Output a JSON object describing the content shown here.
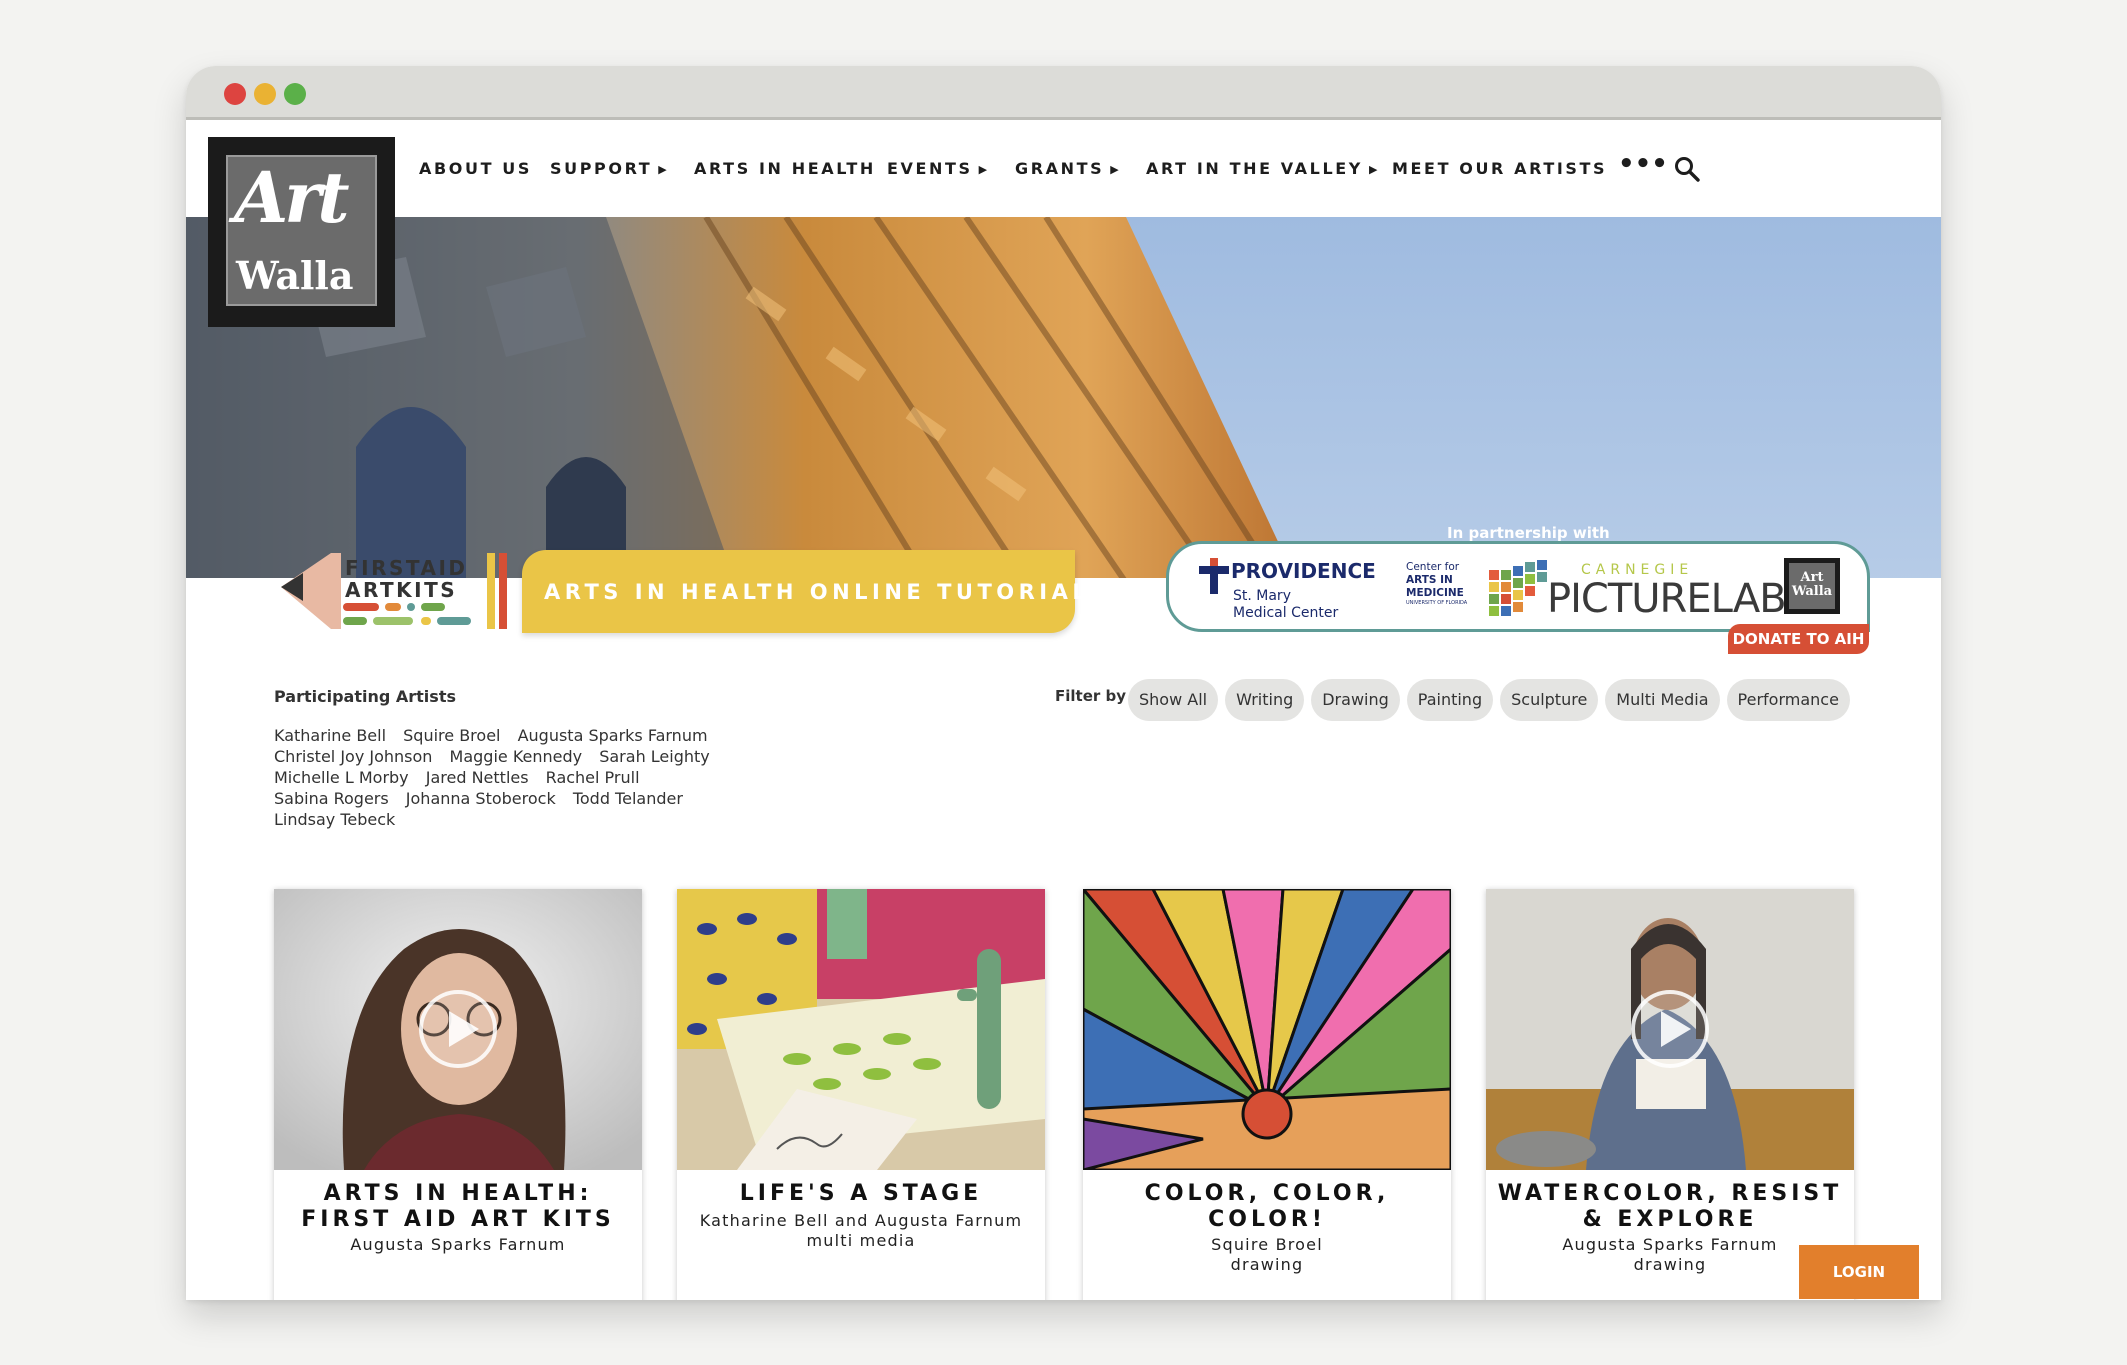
{
  "nav": {
    "about": "ABOUT US",
    "support": "SUPPORT",
    "arts_in_health": "ARTS IN HEALTH",
    "events": "EVENTS",
    "grants": "GRANTS",
    "art_in_valley": "ART IN THE VALLEY",
    "meet_artists": "MEET OUR ARTISTS",
    "more": "•••",
    "caret": "▶"
  },
  "logo": {
    "line1": "Art",
    "line2": "Walla"
  },
  "banner": {
    "first_aid_line1": "FIRSTAID",
    "first_aid_line2": "ARTKITS",
    "tutorials": "ARTS IN HEALTH ONLINE TUTORIALS"
  },
  "partners": {
    "label": "In partnership with",
    "providence": "PROVIDENCE",
    "providence_sub1": "St. Mary",
    "providence_sub2": "Medical Center",
    "cam_line1": "Center for",
    "cam_line2": "ARTS IN",
    "cam_line3": "MEDICINE",
    "cam_line4": "UNIVERSITY OF FLORIDA",
    "carnegie": "CARNEGIE",
    "picturelab": "PICTURELAB",
    "mini_logo_1": "Art",
    "mini_logo_2": "Walla"
  },
  "donate": "DONATE TO AIH",
  "participating": {
    "title": "Participating Artists",
    "artists": [
      "Katharine Bell",
      "Squire Broel",
      "Augusta Sparks Farnum",
      "Christel Joy Johnson",
      "Maggie Kennedy",
      "Sarah Leighty",
      "Michelle L Morby",
      "Jared Nettles",
      "Rachel Prull",
      "Sabina Rogers",
      "Johanna Stoberock",
      "Todd Telander",
      "Lindsay Tebeck"
    ]
  },
  "filter": {
    "label": "Filter by",
    "options": [
      "Show All",
      "Writing",
      "Drawing",
      "Painting",
      "Sculpture",
      "Multi Media",
      "Performance"
    ]
  },
  "cards": [
    {
      "title1": "ARTS IN HEALTH:",
      "title2": "FIRST AID ART KITS",
      "sub1": "Augusta Sparks Farnum",
      "sub2": ""
    },
    {
      "title1": "LIFE'S A STAGE",
      "title2": "",
      "sub1": "Katharine Bell and Augusta Farnum",
      "sub2": "multi media"
    },
    {
      "title1": "COLOR, COLOR,",
      "title2": "COLOR!",
      "sub1": "Squire Broel",
      "sub2": "drawing"
    },
    {
      "title1": "WATERCOLOR, RESIST",
      "title2": "& EXPLORE",
      "sub1": "Augusta Sparks Farnum",
      "sub2": "drawing"
    }
  ],
  "login": "LOGIN",
  "colors": {
    "accent_yellow": "#eac547",
    "donate_red": "#d64f35",
    "login_orange": "#e27f2c",
    "partner_teal": "#5f9b96"
  }
}
